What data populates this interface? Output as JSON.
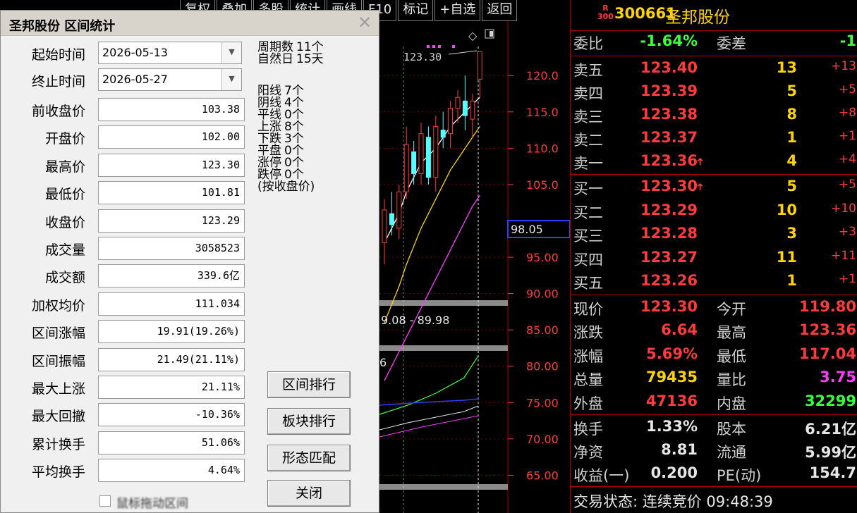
{
  "toolbar": [
    "复权",
    "叠加",
    "多股",
    "统计",
    "画线",
    "F10",
    "标记",
    "+自选",
    "返回"
  ],
  "chart": {
    "price_ticks": [
      "120.0",
      "115.0",
      "110.0",
      "105.0",
      "95.00",
      "90.00",
      "85.00",
      "80.00",
      "75.00",
      "70.00",
      "65.00"
    ],
    "current_price_label": "98.05",
    "high_annotation": "123.30",
    "range_label": "9.08 - 89.98",
    "sub_label": "6",
    "colors": {
      "up": "#ff3b3b",
      "down": "#54ffff",
      "ma5": "#ffffff",
      "ma10": "#ffd200",
      "ma20": "#ff3bff",
      "axis": "#ff3b3b"
    }
  },
  "chart_data": {
    "type": "candlestick",
    "ylim": [
      63,
      124
    ],
    "candles": [
      {
        "open": 97.0,
        "close": 101.5,
        "high": 103.0,
        "low": 94.0
      },
      {
        "open": 101.0,
        "close": 99.5,
        "high": 104.0,
        "low": 98.0
      },
      {
        "open": 99.0,
        "close": 104.0,
        "high": 105.0,
        "low": 97.5
      },
      {
        "open": 104.0,
        "close": 110.5,
        "high": 113.0,
        "low": 103.0
      },
      {
        "open": 109.5,
        "close": 106.5,
        "high": 111.0,
        "low": 105.0
      },
      {
        "open": 106.5,
        "close": 112.0,
        "high": 113.5,
        "low": 105.0
      },
      {
        "open": 111.5,
        "close": 106.0,
        "high": 113.0,
        "low": 105.0
      },
      {
        "open": 106.0,
        "close": 113.0,
        "high": 114.5,
        "low": 104.0
      },
      {
        "open": 112.5,
        "close": 111.5,
        "high": 115.0,
        "low": 110.0
      },
      {
        "open": 112.0,
        "close": 115.5,
        "high": 116.5,
        "low": 110.0
      },
      {
        "open": 115.5,
        "close": 117.0,
        "high": 118.0,
        "low": 113.5
      },
      {
        "open": 116.5,
        "close": 114.5,
        "high": 120.0,
        "low": 112.5
      },
      {
        "open": 114.0,
        "close": 116.5,
        "high": 117.5,
        "low": 111.5
      },
      {
        "open": 119.5,
        "close": 123.3,
        "high": 123.3,
        "low": 117.0
      }
    ],
    "ma5": [
      97,
      99,
      101,
      104,
      106,
      108,
      109,
      110,
      111.5,
      113,
      114,
      115,
      116,
      117
    ],
    "ma10": [
      86,
      88.5,
      91,
      94,
      96.5,
      99,
      101,
      103,
      105,
      107,
      108.5,
      110,
      111.5,
      113
    ],
    "ma20": [
      78,
      80,
      82,
      84,
      86,
      88,
      90,
      92,
      94,
      96,
      98,
      100,
      102,
      103.5
    ]
  },
  "quote": {
    "badge_top": "R",
    "badge_bottom": "300",
    "code": "300661",
    "name": "圣邦股份",
    "weibi_label": "委比",
    "weibi_value": "-1.64%",
    "weicha_label": "委差",
    "weicha_value": "-1",
    "sells": [
      {
        "label": "卖五",
        "price": "123.40",
        "vol": "13",
        "chg": "+13"
      },
      {
        "label": "卖四",
        "price": "123.39",
        "vol": "5",
        "chg": "+5"
      },
      {
        "label": "卖三",
        "price": "123.38",
        "vol": "8",
        "chg": "+8"
      },
      {
        "label": "卖二",
        "price": "123.37",
        "vol": "1",
        "chg": "+1"
      },
      {
        "label": "卖一",
        "price": "123.36",
        "vol": "4",
        "chg": "+4"
      }
    ],
    "buys": [
      {
        "label": "买一",
        "price": "123.30",
        "vol": "5",
        "chg": "+5"
      },
      {
        "label": "买二",
        "price": "123.29",
        "vol": "10",
        "chg": "+10"
      },
      {
        "label": "买三",
        "price": "123.28",
        "vol": "3",
        "chg": "+3"
      },
      {
        "label": "买四",
        "price": "123.27",
        "vol": "11",
        "chg": "+11"
      },
      {
        "label": "买五",
        "price": "123.26",
        "vol": "1",
        "chg": "+1"
      }
    ],
    "stats": [
      {
        "l1": "现价",
        "v1": "123.30",
        "c1": "#ff3b3b",
        "l2": "今开",
        "v2": "119.80",
        "c2": "#ff3b3b"
      },
      {
        "l1": "涨跌",
        "v1": "6.64",
        "c1": "#ff3b3b",
        "l2": "最高",
        "v2": "123.36",
        "c2": "#ff3b3b"
      },
      {
        "l1": "涨幅",
        "v1": "5.69%",
        "c1": "#ff3b3b",
        "l2": "最低",
        "v2": "117.04",
        "c2": "#ff3b3b"
      },
      {
        "l1": "总量",
        "v1": "79435",
        "c1": "#ffd200",
        "l2": "量比",
        "v2": "3.75",
        "c2": "#ff3bff"
      },
      {
        "l1": "外盘",
        "v1": "47136",
        "c1": "#ff3b3b",
        "l2": "内盘",
        "v2": "32299",
        "c2": "#3bff3b"
      },
      {
        "l1": "换手",
        "v1": "1.33%",
        "c1": "#e6e6e6",
        "l2": "股本",
        "v2": "6.21亿",
        "c2": "#e6e6e6"
      },
      {
        "l1": "净资",
        "v1": "8.81",
        "c1": "#e6e6e6",
        "l2": "流通",
        "v2": "5.99亿",
        "c2": "#e6e6e6"
      },
      {
        "l1": "收益(一)",
        "v1": "0.200",
        "c1": "#e6e6e6",
        "l2": "PE(动)",
        "v2": "154.7",
        "c2": "#e6e6e6"
      }
    ],
    "trade_status": "交易状态: 连续竞价 09:48:39"
  },
  "dialog": {
    "title": "圣邦股份 区间统计",
    "start_label": "起始时间",
    "start_value": "2026-05-13",
    "end_label": "终止时间",
    "end_value": "2026-05-27",
    "fields": [
      {
        "label": "前收盘价",
        "value": "103.38"
      },
      {
        "label": "开盘价",
        "value": "102.00"
      },
      {
        "label": "最高价",
        "value": "123.30"
      },
      {
        "label": "最低价",
        "value": "101.81"
      },
      {
        "label": "收盘价",
        "value": "123.29"
      },
      {
        "label": "成交量",
        "value": "3058523"
      },
      {
        "label": "成交额",
        "value": "339.6亿"
      },
      {
        "label": "加权均价",
        "value": "111.034"
      },
      {
        "label": "区间涨幅",
        "value": "19.91(19.26%)"
      },
      {
        "label": "区间振幅",
        "value": "21.49(21.11%)"
      },
      {
        "label": "最大上涨",
        "value": "21.11%"
      },
      {
        "label": "最大回撤",
        "value": "-10.36%"
      },
      {
        "label": "累计换手",
        "value": "51.06%"
      },
      {
        "label": "平均换手",
        "value": "4.64%"
      }
    ],
    "period_stats": [
      {
        "label": "周期数",
        "value": "11个"
      },
      {
        "label": "自然日",
        "value": "15天"
      }
    ],
    "count_stats": [
      {
        "label": "阳线",
        "value": "7个"
      },
      {
        "label": "阴线",
        "value": "4个"
      },
      {
        "label": "平线",
        "value": "0个"
      },
      {
        "label": "上涨",
        "value": "8个"
      },
      {
        "label": "下跌",
        "value": "3个"
      },
      {
        "label": "平盘",
        "value": "0个"
      },
      {
        "label": "涨停",
        "value": "0个"
      },
      {
        "label": "跌停",
        "value": "0个"
      }
    ],
    "count_note": "(按收盘价)",
    "buttons": [
      "区间排行",
      "板块排行",
      "形态匹配",
      "关闭"
    ],
    "checkbox_label": "鼠标拖动区间"
  }
}
